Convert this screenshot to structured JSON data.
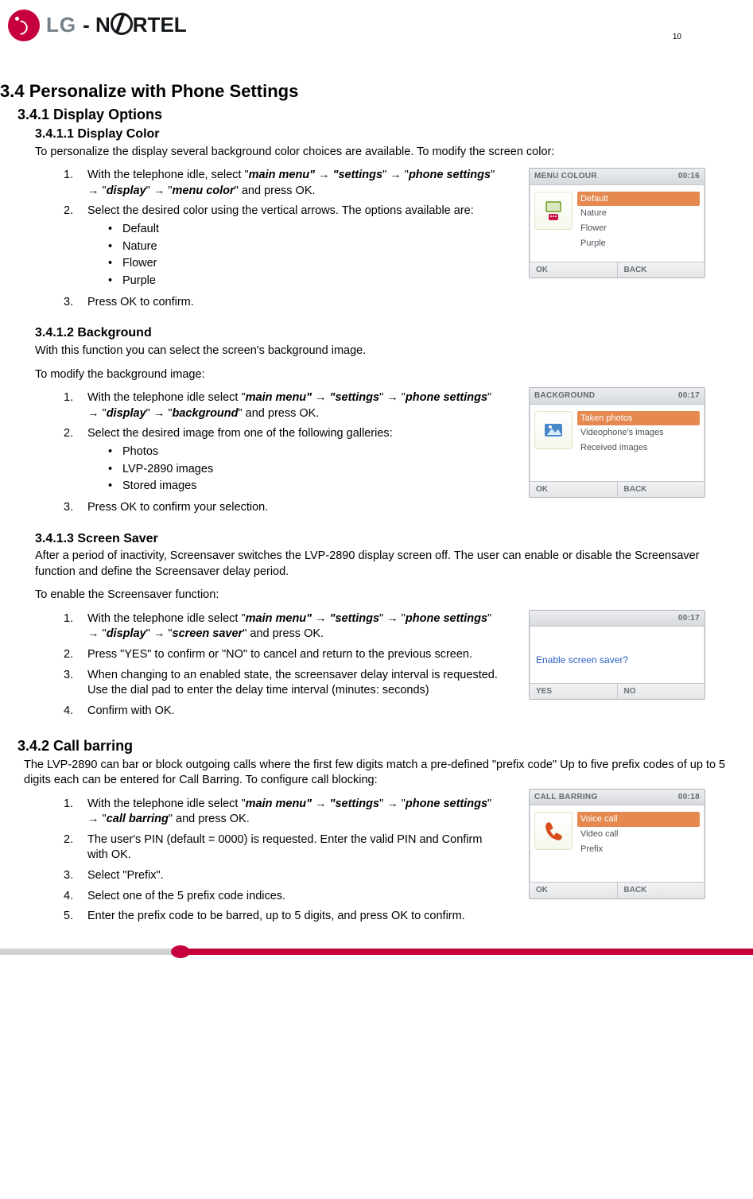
{
  "page_number": "10",
  "logo": {
    "brand1": "LG",
    "brand2": "NORTEL"
  },
  "h_3_4": "3.4    Personalize with Phone Settings",
  "h_3_4_1": "3.4.1    Display Options",
  "h_3_4_1_1": "3.4.1.1    Display Color",
  "p_3_4_1_1_intro": "To personalize the display several background color choices are available. To modify the screen color:",
  "steps_color": {
    "s1_a": "With the telephone idle, select \"",
    "s1_b1": "main menu\" → \"settings",
    "s1_c": "\" → \"",
    "s1_b2": "phone settings",
    "s1_d": "\" → \"",
    "s1_b3": "display",
    "s1_e": "\" → \"",
    "s1_b4": "menu color",
    "s1_f": "\" and press OK.",
    "s2": "Select the desired color using the vertical arrows. The options available are:",
    "opt1": "Default",
    "opt2": "Nature",
    "opt3": "Flower",
    "opt4": "Purple",
    "s3": "Press OK to confirm."
  },
  "shot_color": {
    "title": "MENU COLOUR",
    "time": "00:16",
    "items": [
      "Default",
      "Nature",
      "Flower",
      "Purple"
    ],
    "selected_index": 0,
    "left": "OK",
    "right": "BACK"
  },
  "h_3_4_1_2": "3.4.1.2    Background",
  "p_3_4_1_2_a": "With this function you can select the screen's background image.",
  "p_3_4_1_2_b": "To modify the background image:",
  "steps_bg": {
    "s1_a": "With the telephone idle select \"",
    "s1_b1": "main menu\" → \"settings",
    "s1_c": "\" → \"",
    "s1_b2": "phone settings",
    "s1_d": "\" → \"",
    "s1_b3": "display",
    "s1_e": "\" → \"",
    "s1_b4": "background",
    "s1_f": "\" and press OK.",
    "s2": "Select the desired image from one of the following galleries:",
    "opt1": "Photos",
    "opt2": "LVP-2890 images",
    "opt3": "Stored images",
    "s3": "Press OK to confirm your selection."
  },
  "shot_bg": {
    "title": "BACKGROUND",
    "time": "00:17",
    "items": [
      "Taken photos",
      "Videophone's images",
      "Received images"
    ],
    "selected_index": 0,
    "left": "OK",
    "right": "BACK"
  },
  "h_3_4_1_3": "3.4.1.3    Screen Saver",
  "p_3_4_1_3_a": "After a period of inactivity, Screensaver switches the LVP-2890 display screen off.  The user can enable or disable the Screensaver function and define the Screensaver delay period.",
  "p_3_4_1_3_b": "To enable the Screensaver function:",
  "steps_ss": {
    "s1_a": "With the telephone idle select \"",
    "s1_b1": "main menu\" → \"settings",
    "s1_c": "\" → \"",
    "s1_b2": "phone settings",
    "s1_d": "\" → \"",
    "s1_b3": "display",
    "s1_e": "\" → \"",
    "s1_b4": "screen saver",
    "s1_f": "\" and press OK.",
    "s2": "Press \"YES\" to confirm or \"NO\" to cancel and return to the previous screen.",
    "s3": "When changing to an enabled state, the screensaver delay interval is requested. Use the dial pad to enter the delay time interval (minutes: seconds)",
    "s4": "Confirm with OK."
  },
  "shot_ss": {
    "title": "",
    "time": "00:17",
    "prompt": "Enable screen saver?",
    "left": "YES",
    "right": "NO"
  },
  "h_3_4_2": "3.4.2    Call barring",
  "p_3_4_2_a": "The LVP-2890 can bar or block outgoing calls where the first few digits match a pre-defined \"prefix code\" Up to five prefix codes of up to 5 digits each can be entered for Call Barring. To configure call blocking:",
  "steps_cb": {
    "s1_a": "With the telephone idle select \"",
    "s1_b1": "main menu\" → \"settings",
    "s1_c": "\" → \"",
    "s1_b2": "phone settings",
    "s1_d": "\" → \"",
    "s1_b3": "call barring",
    "s1_e": "\" and press OK.",
    "s2": "The user's PIN (default = 0000) is requested. Enter the valid PIN and Confirm with OK.",
    "s3": "Select \"Prefix\".",
    "s4": "Select one of the 5 prefix code indices.",
    "s5": "Enter the prefix code to be barred, up to 5 digits, and press OK to confirm."
  },
  "shot_cb": {
    "title": "CALL BARRING",
    "time": "00:18",
    "items": [
      "Voice call",
      "Video call",
      "Prefix"
    ],
    "selected_index": 0,
    "left": "OK",
    "right": "BACK"
  }
}
